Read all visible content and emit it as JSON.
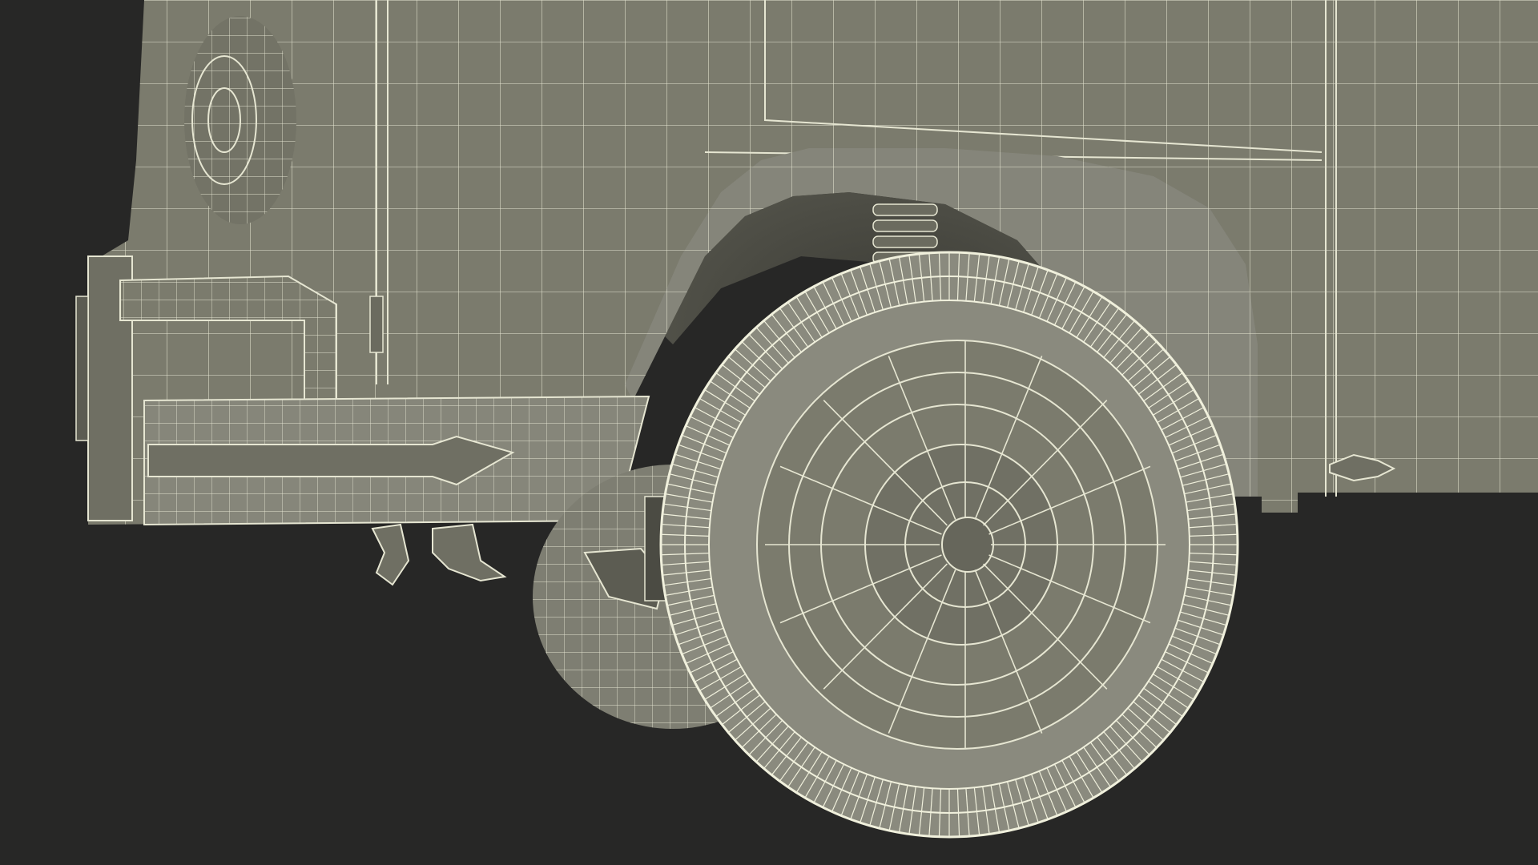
{
  "scene": {
    "subject": "vehicle-wireframe-render",
    "colors": {
      "background": "#272726",
      "surface": "#7b7b6d",
      "surface_dark": "#5c5c52",
      "surface_shadow": "#44443d",
      "wire": "#e6e6d2",
      "wire_dense": "#f0f0dc"
    }
  }
}
